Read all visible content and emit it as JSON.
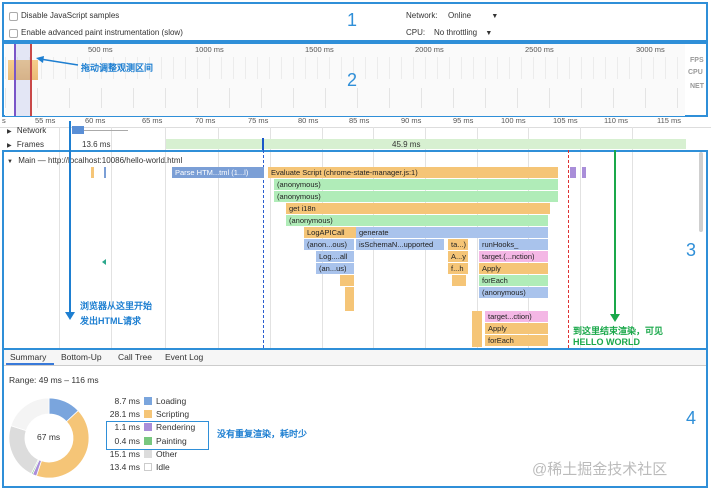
{
  "top": {
    "disable_js": "Disable JavaScript samples",
    "advanced_paint": "Enable advanced paint instrumentation (slow)",
    "network_label": "Network:",
    "network_value": "Online",
    "cpu_label": "CPU:",
    "cpu_value": "No throttling"
  },
  "overview": {
    "ticks": [
      "500 ms",
      "1000 ms",
      "1500 ms",
      "2000 ms",
      "2500 ms",
      "3000 ms"
    ],
    "side_labels": [
      "FPS",
      "CPU",
      "NET"
    ],
    "annotation": "拖动调整观测区间"
  },
  "ruler": {
    "ticks": [
      "s",
      "55 ms",
      "60 ms",
      "65 ms",
      "70 ms",
      "75 ms",
      "80 ms",
      "85 ms",
      "90 ms",
      "95 ms",
      "100 ms",
      "105 ms",
      "110 ms",
      "115 ms"
    ]
  },
  "tracks": {
    "network": "Network",
    "frames": "Frames",
    "frame1": "13.6 ms",
    "frame2": "45.9 ms",
    "main": "Main — http://localhost:10086/hello-world.html"
  },
  "flame": {
    "parse": "Parse HTM...tml (1...l)",
    "eval": "Evaluate Script (chrome-state-manager.js:1)",
    "anon1": "(anonymous)",
    "anon2": "(anonymous)",
    "geti18n": "get i18n",
    "anon3": "(anonymous)",
    "logapi": "LogAPICall",
    "generate": "generate",
    "anonous": "(anon...ous)",
    "isschema": "isSchemaN...upported",
    "ta": "ta...)",
    "runhooks": "runHooks_",
    "logall": "Log....all",
    "a_small": "A...y",
    "target1": "target.(...nction)",
    "anus": "(an...us)",
    "fh": "f...h",
    "apply1": "Apply",
    "foreach1": "forEach",
    "anon4": "(anonymous)",
    "target2": "target...ction)",
    "apply2": "Apply",
    "foreach2": "forEach"
  },
  "notes": {
    "request": "浏览器从这里开始\n发出HTML请求",
    "end_line1": "到这里结束渲染，可见",
    "end_line2": "HELLO WORLD",
    "no_repaint": "没有重复渲染，耗时少"
  },
  "tabs": [
    "Summary",
    "Bottom-Up",
    "Call Tree",
    "Event Log"
  ],
  "summary": {
    "range": "Range: 49 ms – 116 ms",
    "total": "67 ms",
    "rows": [
      {
        "ms": "8.7 ms",
        "label": "Loading",
        "color": "#7aa5dd",
        "value": 8.7
      },
      {
        "ms": "28.1 ms",
        "label": "Scripting",
        "color": "#f5c577",
        "value": 28.1
      },
      {
        "ms": "1.1 ms",
        "label": "Rendering",
        "color": "#a98ed9",
        "value": 1.1
      },
      {
        "ms": "0.4 ms",
        "label": "Painting",
        "color": "#78c77f",
        "value": 0.4
      },
      {
        "ms": "15.1 ms",
        "label": "Other",
        "color": "#dcdcdc",
        "value": 15.1
      },
      {
        "ms": "13.4 ms",
        "label": "Idle",
        "color": "#ffffff",
        "value": 13.4
      }
    ]
  },
  "regions": [
    "1",
    "2",
    "3",
    "4"
  ],
  "watermark": "@稀土掘金技术社区",
  "colors": {
    "region_border": "#2f8fd8",
    "annotation_blue": "#1e7fd1",
    "annotation_green": "#1aa84a"
  }
}
